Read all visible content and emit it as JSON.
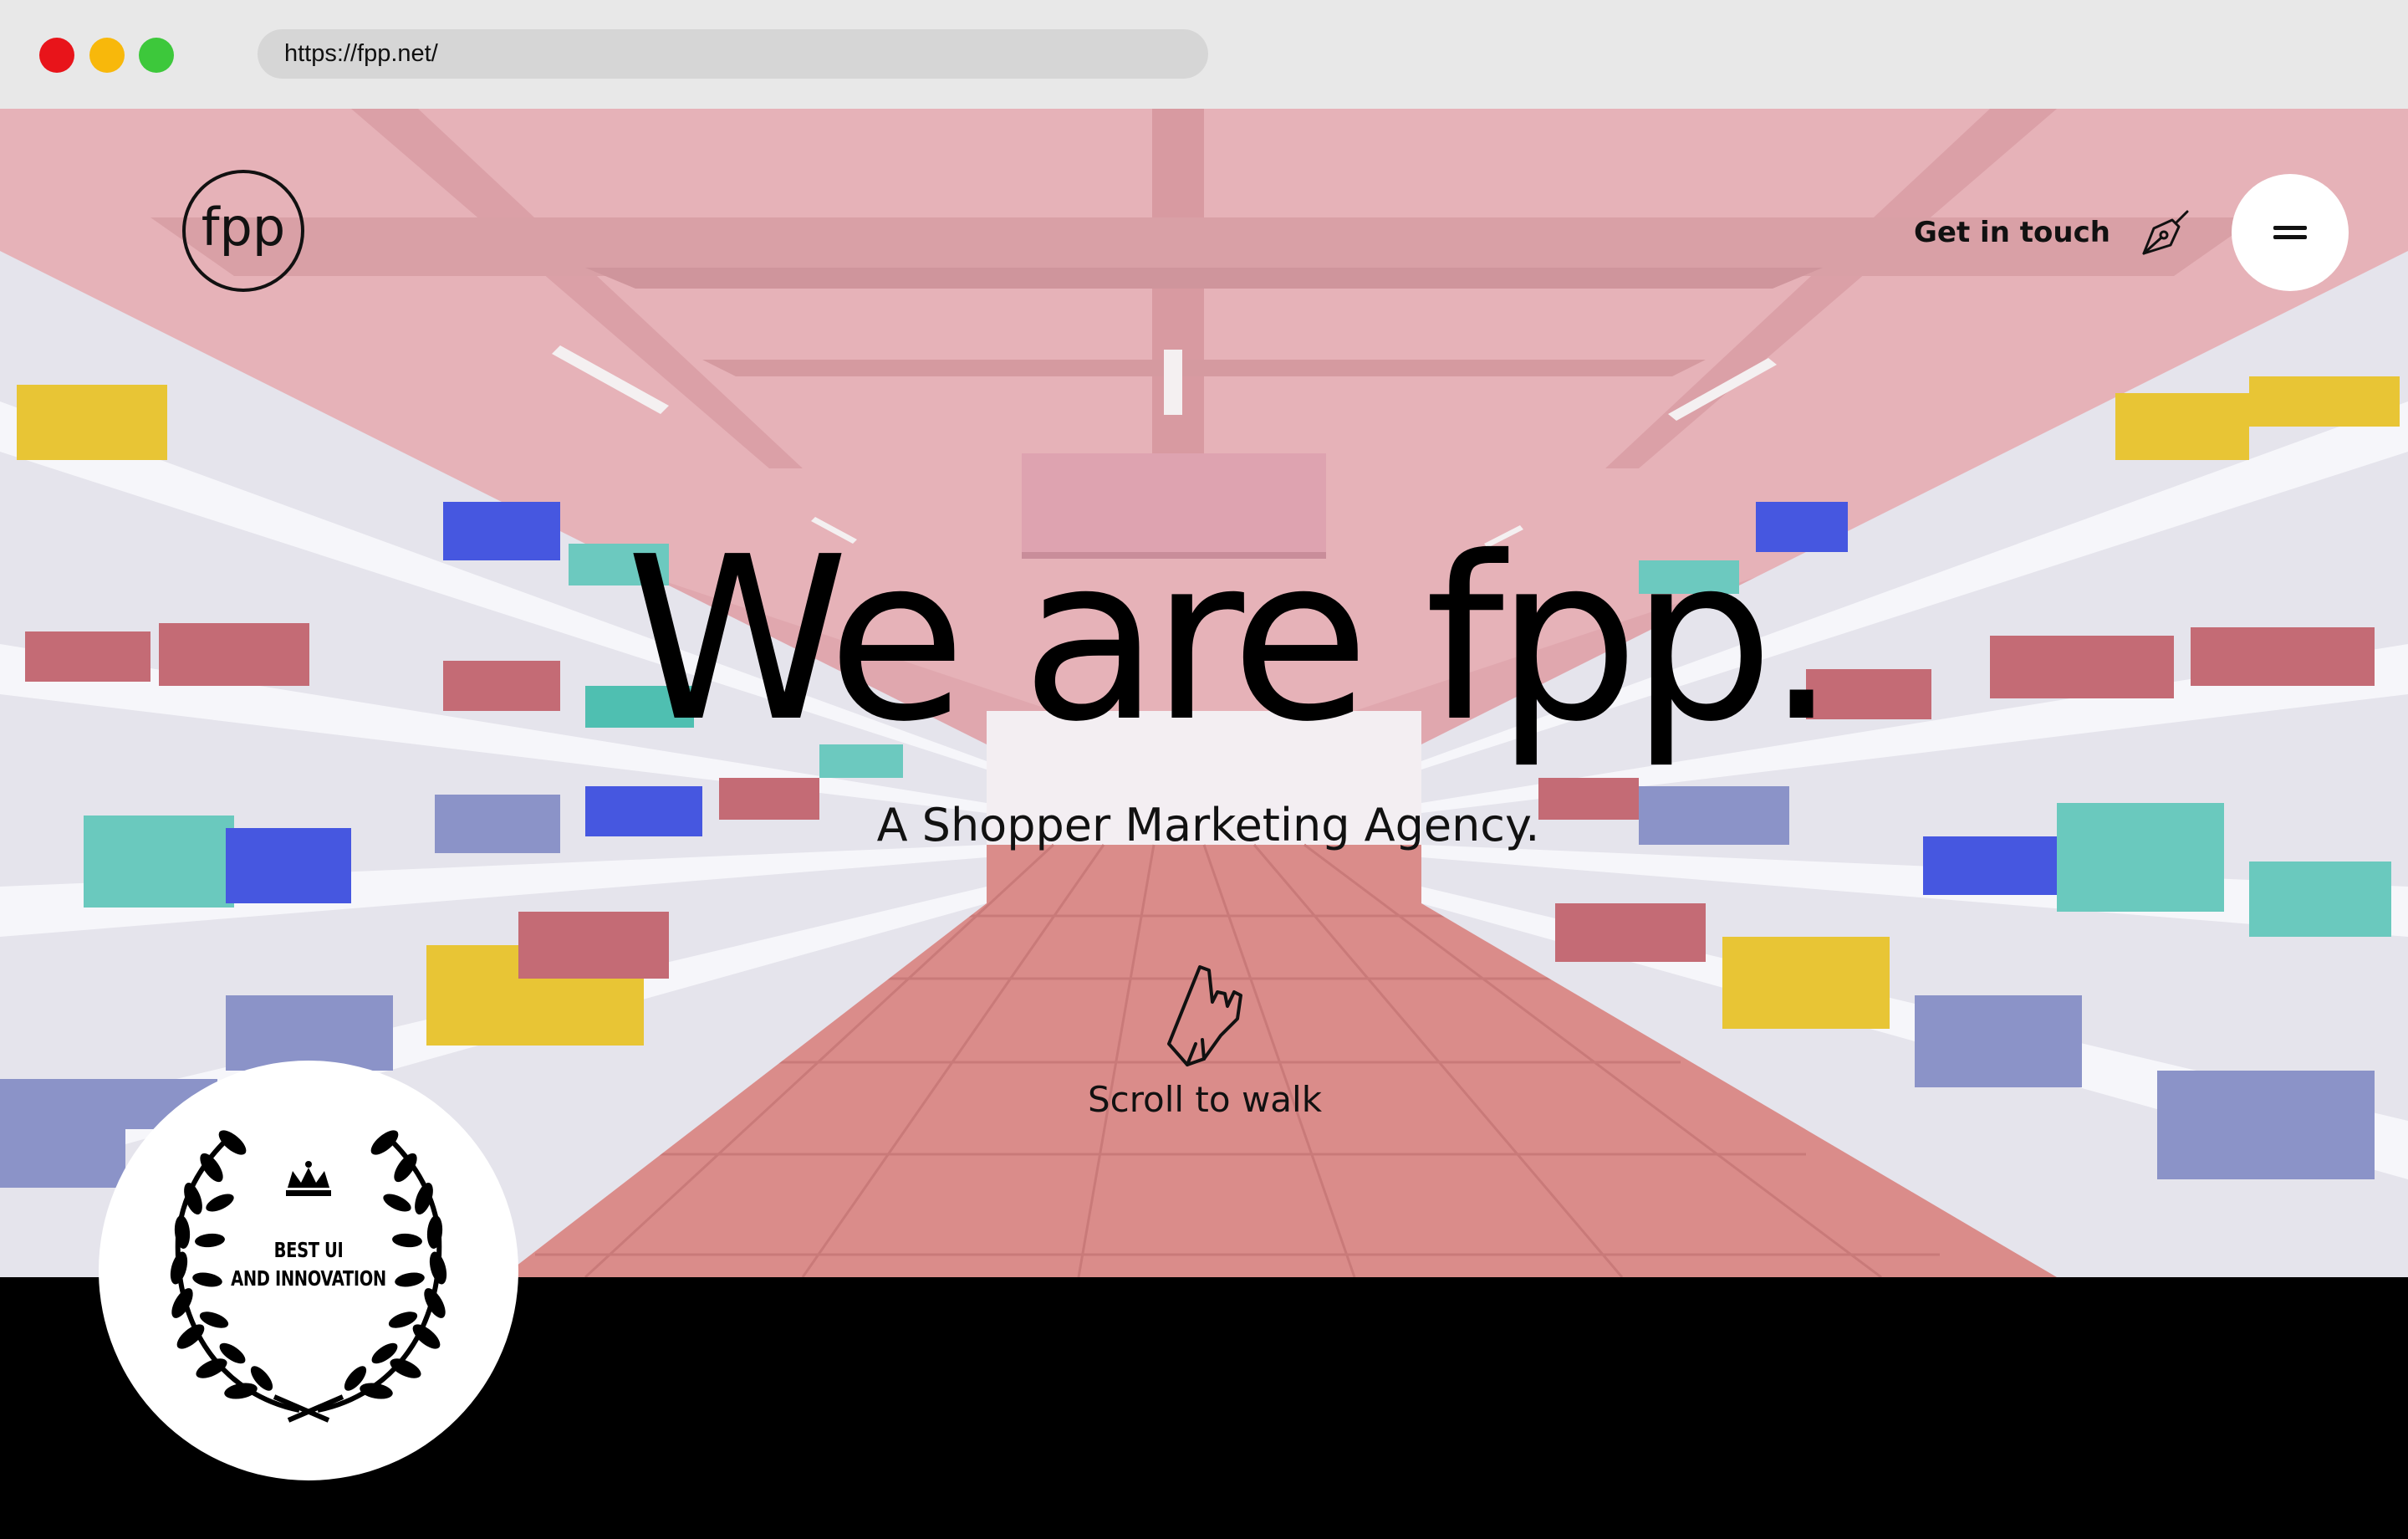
{
  "browser": {
    "url": "https://fpp.net/"
  },
  "header": {
    "logo_text": "fpp",
    "cta_label": "Get in touch",
    "cta_icon": "pen-nib-icon",
    "menu_icon": "hamburger-icon"
  },
  "hero": {
    "title": "We are fpp.",
    "subtitle": "A Shopper Marketing Agency.",
    "scroll_icon": "pointing-hand-icon",
    "scroll_label": "Scroll to walk"
  },
  "award": {
    "line1": "BEST UI",
    "line2": "AND INNOVATION",
    "icon": "crown-icon",
    "wreath": "laurel-wreath-icon"
  },
  "colors": {
    "ceiling": "#e2a9b0",
    "floor": "#db8d8c",
    "shelf": "#f1f1f6",
    "chrome": "#e8e8e8",
    "text": "#111111"
  }
}
